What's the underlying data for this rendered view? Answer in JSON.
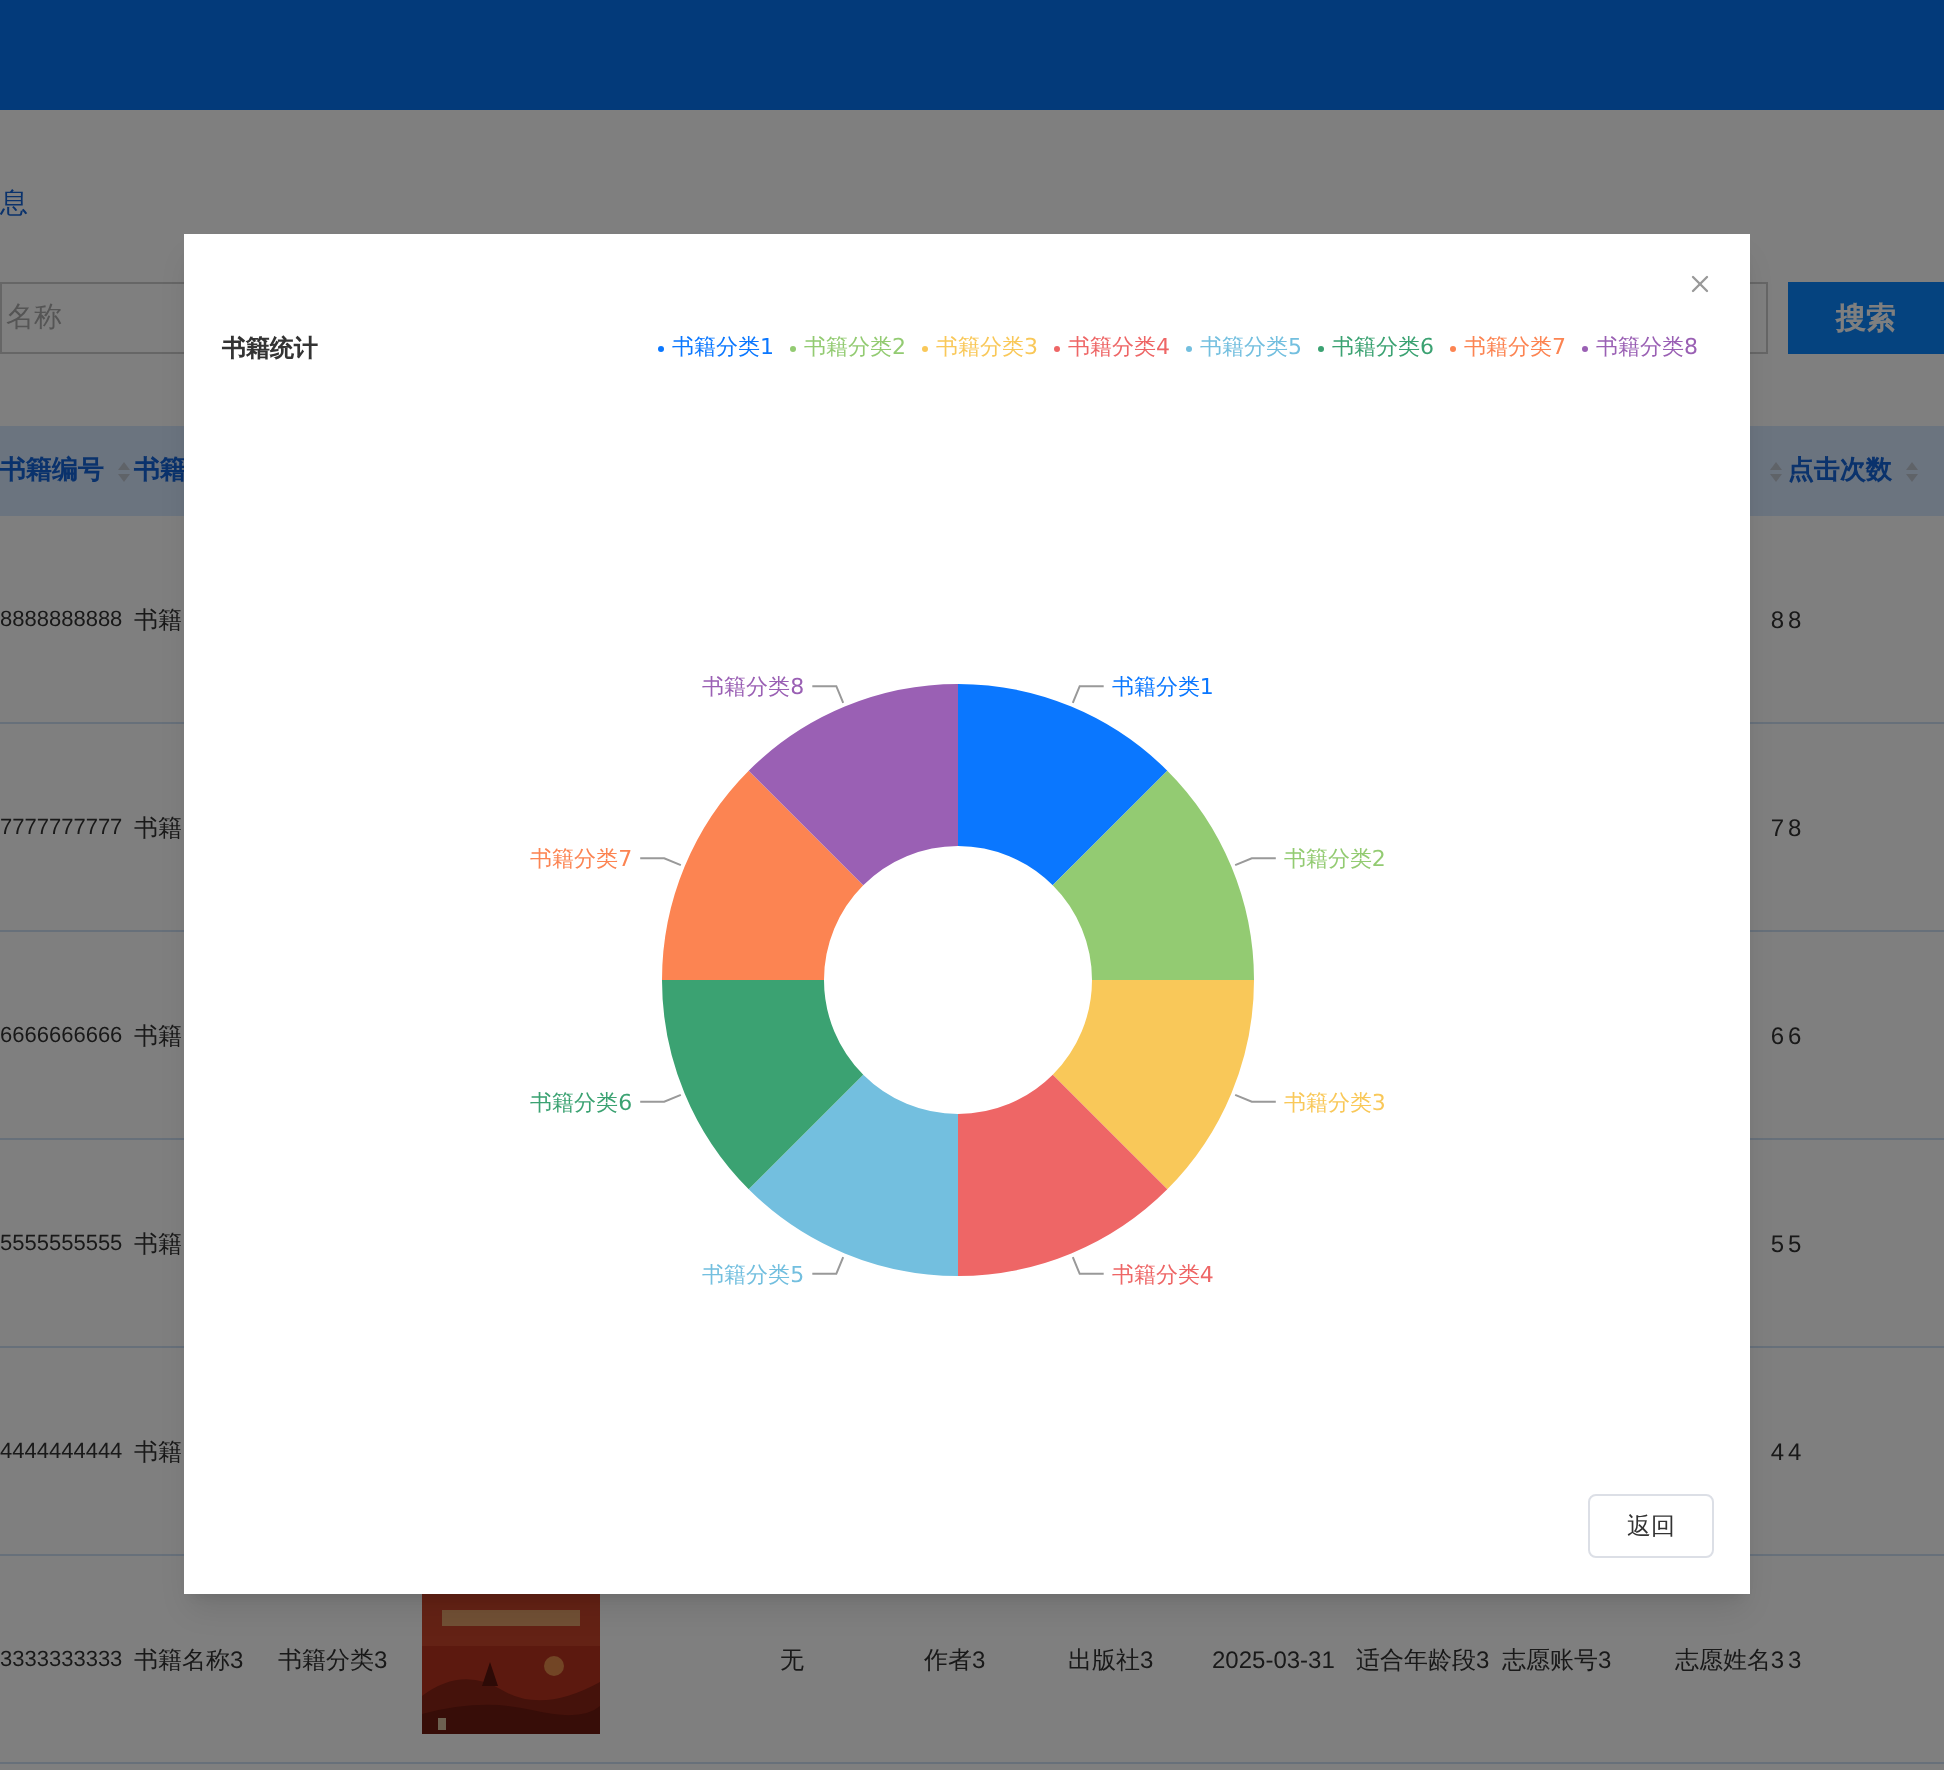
{
  "breadcrumb": "息",
  "search": {
    "placeholder": "名称",
    "button": "搜索"
  },
  "table": {
    "header": {
      "book_no": {
        "label": "书籍编号",
        "sortable": true
      },
      "book_name": {
        "label": "书籍"
      },
      "volunteer_name": {
        "sortable": true
      },
      "clicks": {
        "label": "点击次数",
        "sortable": true
      }
    },
    "rows": [
      {
        "book_no": "8888888888",
        "book_name": "书籍",
        "volunteer_name": "8",
        "clicks": "8"
      },
      {
        "book_no": "7777777777",
        "book_name": "书籍",
        "volunteer_name": "7",
        "clicks": "8"
      },
      {
        "book_no": "6666666666",
        "book_name": "书籍",
        "volunteer_name": "6",
        "clicks": "6"
      },
      {
        "book_no": "5555555555",
        "book_name": "书籍",
        "volunteer_name": "5",
        "clicks": "5"
      },
      {
        "book_no": "4444444444",
        "book_name": "书籍",
        "volunteer_name": "4",
        "clicks": "4"
      },
      {
        "book_no": "3333333333",
        "book_name": "书籍名称3",
        "category": "书籍分类3",
        "column_5": "无",
        "author": "作者3",
        "publisher": "出版社3",
        "date": "2025-03-31",
        "age_range": "适合年龄段3",
        "volunteer_account": "志愿账号3",
        "volunteer_name": "志愿姓名3",
        "clicks": "3"
      }
    ]
  },
  "dialog": {
    "title": "书籍统计",
    "legend": [
      {
        "label": "书籍分类1",
        "color": "#0a77ff"
      },
      {
        "label": "书籍分类2",
        "color": "#93cb72"
      },
      {
        "label": "书籍分类3",
        "color": "#f9c859"
      },
      {
        "label": "书籍分类4",
        "color": "#ee6666"
      },
      {
        "label": "书籍分类5",
        "color": "#73bfdf"
      },
      {
        "label": "书籍分类6",
        "color": "#3ba272"
      },
      {
        "label": "书籍分类7",
        "color": "#fc8452"
      },
      {
        "label": "书籍分类8",
        "color": "#9a60b4"
      }
    ],
    "chart_data": {
      "type": "donut",
      "categories": [
        "书籍分类1",
        "书籍分类2",
        "书籍分类3",
        "书籍分类4",
        "书籍分类5",
        "书籍分类6",
        "书籍分类7",
        "书籍分类8"
      ],
      "values": [
        1,
        1,
        1,
        1,
        1,
        1,
        1,
        1
      ]
    },
    "button": "返回"
  }
}
